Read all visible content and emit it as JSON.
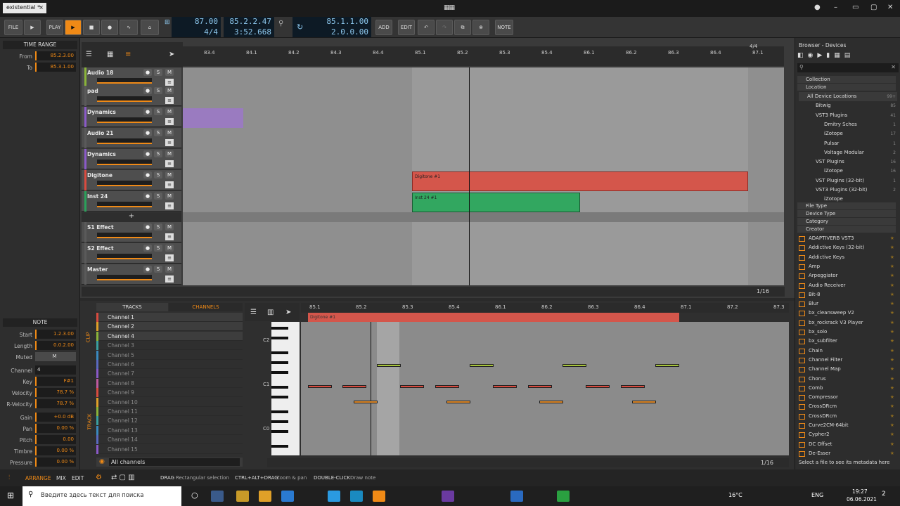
{
  "window": {
    "tab_title": "existential *",
    "close": "×"
  },
  "toolbar": {
    "file": "FILE",
    "play": "PLAY",
    "tempo": "87.00",
    "signature": "4/4",
    "position": "85.2.2.47",
    "time": "3:52.668",
    "loop_start": "85.1.1.00",
    "loop_length": "2.0.0.00",
    "add": "ADD",
    "edit": "EDIT",
    "note": "NOTE"
  },
  "time_range": {
    "title": "TIME RANGE",
    "from_label": "From",
    "from": "85.2.3.00",
    "to_label": "To",
    "to": "85.3.1.00"
  },
  "note_panel": {
    "title": "NOTE",
    "start_label": "Start",
    "start": "1.2.3.00",
    "length_label": "Length",
    "length": "0.0.2.00",
    "muted_label": "Muted",
    "muted": "M",
    "channel_label": "Channel",
    "channel": "4",
    "key_label": "Key",
    "key": "F#1",
    "velocity_label": "Velocity",
    "velocity": "78.7 %",
    "rvel_label": "R-Velocity",
    "rvel": "78.7 %",
    "gain_label": "Gain",
    "gain": "+0.0 dB",
    "pan_label": "Pan",
    "pan": "0.00 %",
    "pitch_label": "Pitch",
    "pitch": "0.00",
    "timbre_label": "Timbre",
    "timbre": "0.00 %",
    "pressure_label": "Pressure",
    "pressure": "0.00 %"
  },
  "tracks": [
    {
      "name": "Audio 18",
      "color": "#8ab43a"
    },
    {
      "name": "pad",
      "color": "#5a5a5a"
    },
    {
      "name": "Dynamics",
      "color": "#8a5ac8"
    },
    {
      "name": "Audio 21",
      "color": "#5a5a5a"
    },
    {
      "name": "Dynamics",
      "color": "#8a5ac8"
    },
    {
      "name": "Digitone",
      "color": "#d94b3f"
    },
    {
      "name": "Inst 24",
      "color": "#2aa05a"
    },
    {
      "name": "S1 Effect",
      "color": "#5a5a5a"
    },
    {
      "name": "S2 Effect",
      "color": "#5a5a5a"
    },
    {
      "name": "Master",
      "color": "#5a5a5a"
    }
  ],
  "buttons": {
    "s": "S",
    "m": "M",
    "add_track": "+"
  },
  "timeline": [
    "83.4",
    "84.1",
    "84.2",
    "84.3",
    "84.4",
    "85.1",
    "85.2",
    "85.3",
    "85.4",
    "86.1",
    "86.2",
    "86.3",
    "86.4",
    "87.1"
  ],
  "timesig_marker": "4/4",
  "clips": {
    "digitone": "Digitone #1",
    "inst24": "Inst 24 #1"
  },
  "grid_label": "1/16",
  "editor": {
    "tracks_tab": "TRACKS",
    "channels_tab": "CHANNELS",
    "clip_label": "CLIP",
    "track_label": "TRACK",
    "all_channels": "All channels",
    "channels": [
      "Channel 1",
      "Channel 2",
      "Channel 4",
      "Channel 3",
      "Channel 5",
      "Channel 6",
      "Channel 7",
      "Channel 8",
      "Channel 9",
      "Channel 10",
      "Channel 11",
      "Channel 12",
      "Channel 13",
      "Channel 14",
      "Channel 15"
    ],
    "timeline": [
      "85.1",
      "85.2",
      "85.3",
      "85.4",
      "86.1",
      "86.2",
      "86.3",
      "86.4",
      "87.1",
      "87.2",
      "87.3"
    ],
    "keys": [
      "C2",
      "C1",
      "C0"
    ],
    "grid": "1/16"
  },
  "browser": {
    "title": "Browser - Devices",
    "sections": [
      "Collection",
      "Location"
    ],
    "locations": [
      {
        "name": "All Device Locations",
        "count": "99+"
      },
      {
        "name": "Bitwig",
        "count": "85"
      },
      {
        "name": "VST3 Plugins",
        "count": "41"
      },
      {
        "name": "Dmitry Sches",
        "count": "1"
      },
      {
        "name": "iZotope",
        "count": "17"
      },
      {
        "name": "Pulsar",
        "count": "1"
      },
      {
        "name": "Voltage Modular",
        "count": "2"
      },
      {
        "name": "VST Plugins",
        "count": "16"
      },
      {
        "name": "iZotope",
        "count": "16"
      },
      {
        "name": "VST Plugins (32-bit)",
        "count": "1"
      },
      {
        "name": "VST3 Plugins (32-bit)",
        "count": "2"
      },
      {
        "name": "iZotope",
        "count": ""
      }
    ],
    "filters": [
      "File Type",
      "Device Type",
      "Category",
      "Creator"
    ],
    "devices": [
      "ADAPTIVERB VST3",
      "Addictive Keys (32-bit)",
      "Addictive Keys",
      "Amp",
      "Arpeggiator",
      "Audio Receiver",
      "Bit-8",
      "Blur",
      "bx_cleansweep V2",
      "bx_rockrack V3 Player",
      "bx_solo",
      "bx_subfilter",
      "Chain",
      "Channel Filter",
      "Channel Map",
      "Chorus",
      "Comb",
      "Compressor",
      "CrossDRcm",
      "CrossDRcm",
      "Curve2CM-64bit",
      "Cypher2",
      "DC Offset",
      "De-Esser"
    ],
    "footer": "Select a file to see its metadata here"
  },
  "statusbar": {
    "arrange": "ARRANGE",
    "mix": "MIX",
    "edit": "EDIT",
    "drag": "DRAG",
    "drag_desc": "Rectangular selection",
    "ctrl": "CTRL+ALT+DRAG",
    "ctrl_desc": "Zoom & pan",
    "dbl": "DOUBLE-CLICK",
    "dbl_desc": "Draw note"
  },
  "taskbar": {
    "search": "Введите здесь текст для поиска",
    "temp": "16°C",
    "lang": "ENG",
    "time": "19:27",
    "date": "06.06.2021",
    "notif": "2"
  }
}
